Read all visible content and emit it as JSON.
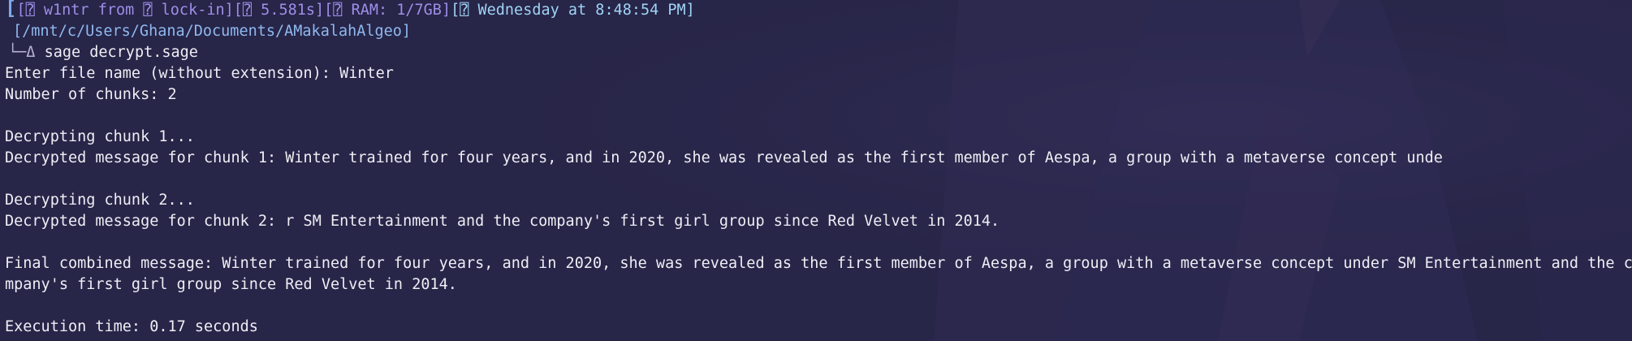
{
  "prompt": {
    "user_segment": "[⍰ w1ntr from ⍰ lock-in]",
    "time_segment": "[⍰ 5.581s]",
    "ram_segment": "[⍰ RAM: 1/7GB]",
    "date_segment": "[⍰ Wednesday at 8:48:54 PM]",
    "path": "[/mnt/c/Users/Ghana/Documents/AMakalahAlgeo]",
    "arrow": "└─Δ",
    "command": "sage decrypt.sage"
  },
  "output": [
    "Enter file name (without extension): Winter",
    "Number of chunks: 2",
    "",
    "Decrypting chunk 1...",
    "Decrypted message for chunk 1: Winter trained for four years, and in 2020, she was revealed as the first member of Aespa, a group with a metaverse concept unde",
    "",
    "Decrypting chunk 2...",
    "Decrypted message for chunk 2: r SM Entertainment and the company's first girl group since Red Velvet in 2014.",
    "",
    "Final combined message: Winter trained for four years, and in 2020, she was revealed as the first member of Aespa, a group with a metaverse concept under SM Entertainment and the co",
    "mpany's first girl group since Red Velvet in 2014.",
    "",
    "Execution time: 0.17 seconds"
  ],
  "colors": {
    "background": "#272548",
    "text": "#eeeef4",
    "prompt_purple": "#9c8fe8",
    "prompt_cyan": "#9fd3f5",
    "path_blue": "#8fb8ee"
  }
}
